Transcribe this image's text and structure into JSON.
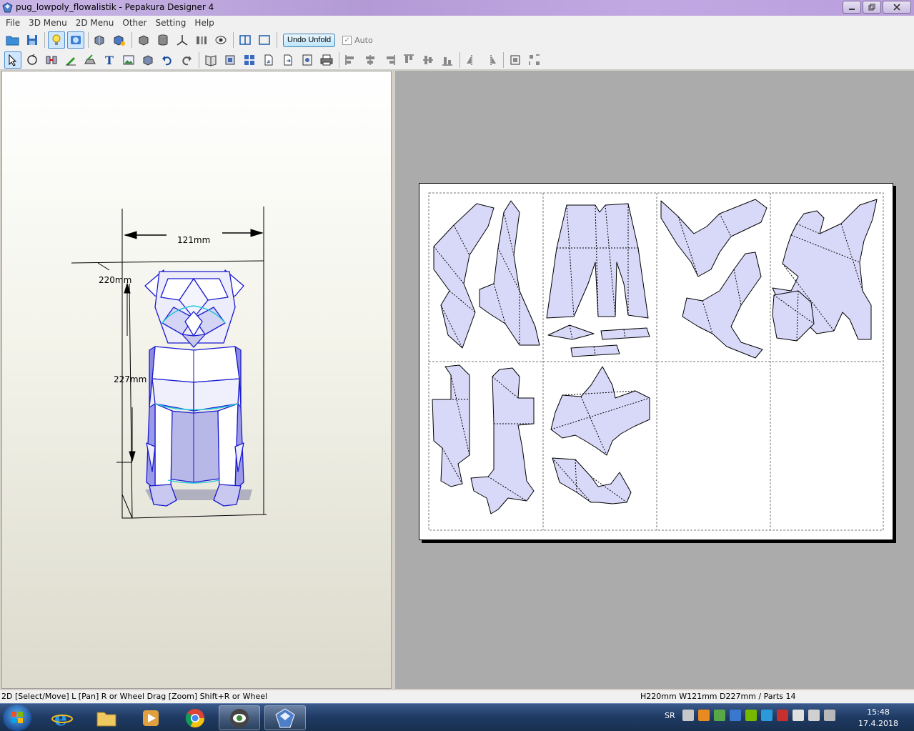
{
  "window": {
    "title": "pug_lowpoly_flowalistik - Pepakura Designer 4"
  },
  "menu": [
    "File",
    "3D Menu",
    "2D Menu",
    "Other",
    "Setting",
    "Help"
  ],
  "toolbar": {
    "undo_unfold_label": "Undo Unfold",
    "auto_label": "Auto",
    "auto_checked": true
  },
  "model3d": {
    "dim_width": "121mm",
    "dim_height": "220mm",
    "dim_depth": "227mm"
  },
  "status": {
    "mode_hint": "2D [Select/Move] L [Pan] R or Wheel Drag [Zoom] Shift+R or Wheel",
    "model_info": "H220mm W121mm D227mm / Parts 14"
  },
  "taskbar": {
    "language": "SR",
    "time": "15:48",
    "date": "17.4.2018"
  },
  "colors": {
    "part_fill": "#d8d8f8",
    "model_edge": "#1a1ad0",
    "seam": "#22c8d8"
  }
}
